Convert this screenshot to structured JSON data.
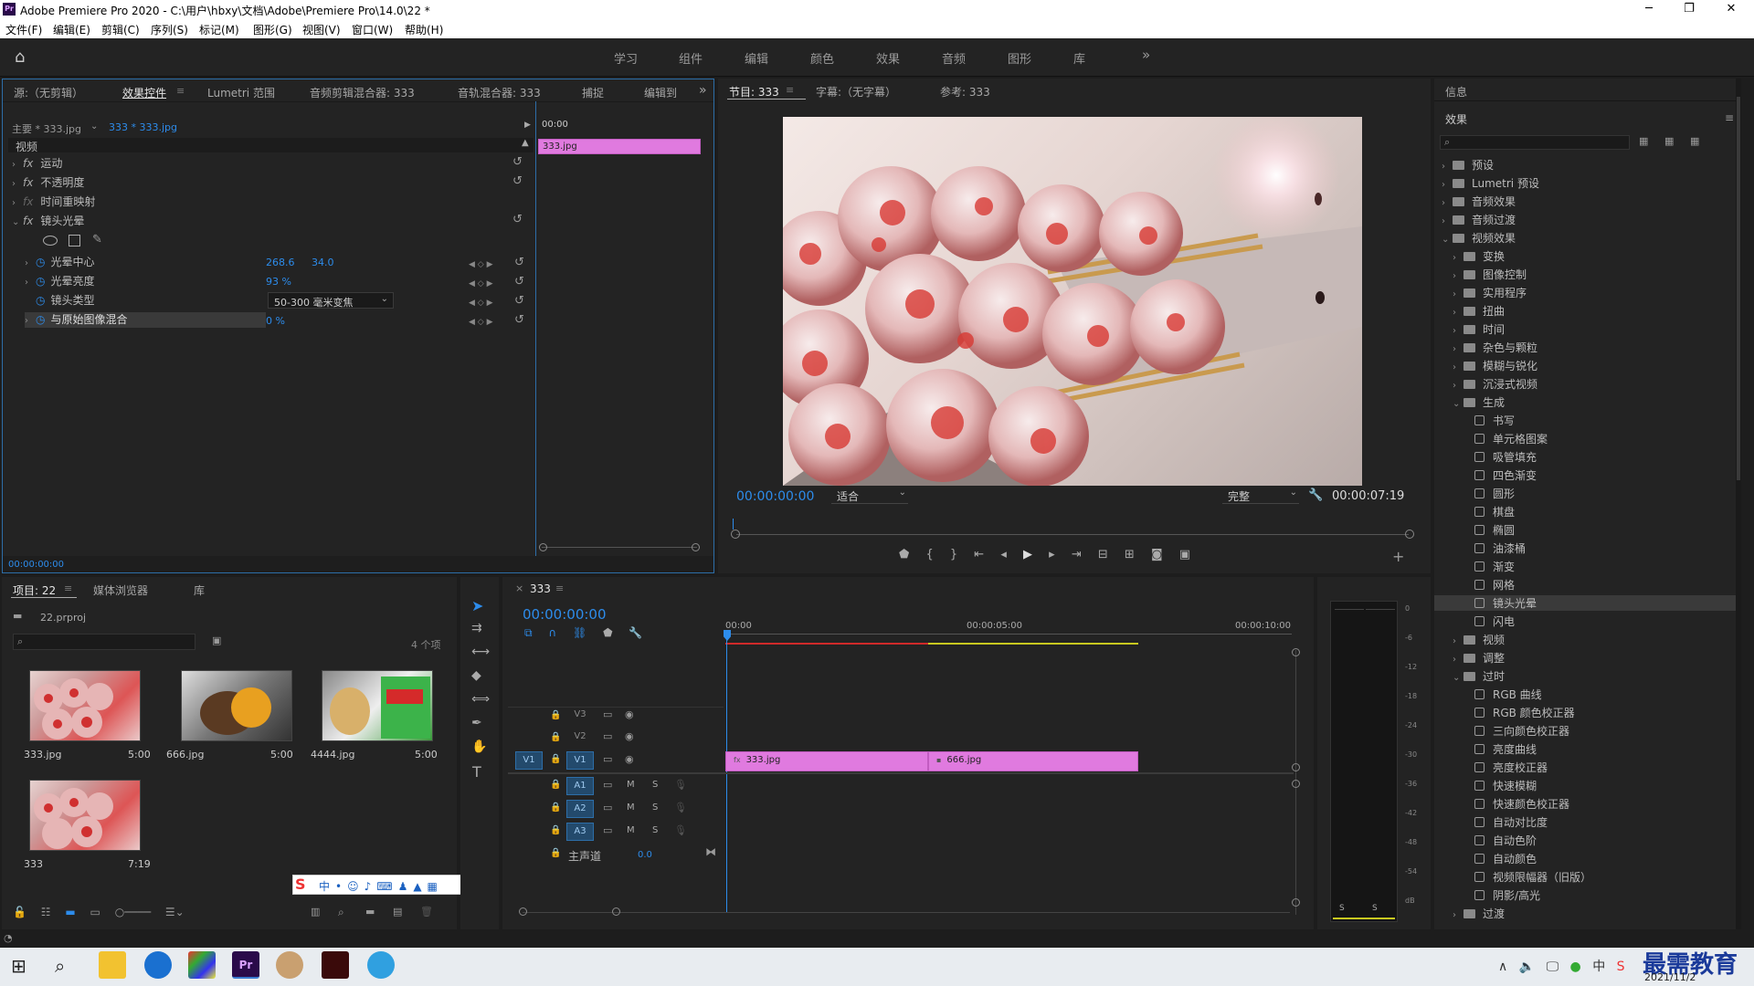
{
  "titlebar": {
    "app_icon": "Pr",
    "title": "Adobe Premiere Pro 2020 - C:\\用户\\hbxy\\文档\\Adobe\\Premiere Pro\\14.0\\22 *",
    "minimize": "─",
    "maximize": "❐",
    "close": "✕"
  },
  "menu": [
    "文件(F)",
    "编辑(E)",
    "剪辑(C)",
    "序列(S)",
    "标记(M)",
    "图形(G)",
    "视图(V)",
    "窗口(W)",
    "帮助(H)"
  ],
  "workspaces": [
    "学习",
    "组件",
    "编辑",
    "颜色",
    "效果",
    "音频",
    "图形",
    "库"
  ],
  "workspace_more": "»",
  "effect_controls": {
    "tabs": [
      "源:（无剪辑）",
      "效果控件",
      "Lumetri 范围",
      "音频剪辑混合器: 333",
      "音轨混合器: 333",
      "捕捉",
      "编辑到"
    ],
    "master": "主要 * 333.jpg",
    "clip": "333 * 333.jpg",
    "timecode_start": "00:00",
    "clip_label": "333.jpg",
    "section": "视频",
    "effects": [
      "运动",
      "不透明度",
      "时间重映射",
      "镜头光晕"
    ],
    "params": [
      {
        "name": "光晕中心",
        "v1": "268.6",
        "v2": "34.0"
      },
      {
        "name": "光晕亮度",
        "v1": "93 %"
      },
      {
        "name": "镜头类型",
        "v1": "50-300 毫米变焦"
      },
      {
        "name": "与原始图像混合",
        "v1": "0 %"
      }
    ],
    "timecode": "00:00:00:00"
  },
  "program": {
    "tabs": [
      "节目: 333",
      "字幕:（无字幕）",
      "参考: 333"
    ],
    "timecode": "00:00:00:00",
    "fit": "适合",
    "quality": "完整",
    "duration": "00:00:07:19"
  },
  "effects_panel": {
    "info_title": "信息",
    "title": "效果",
    "tree": [
      {
        "label": "预设",
        "level": 0,
        "type": "folder",
        "open": false
      },
      {
        "label": "Lumetri 预设",
        "level": 0,
        "type": "folder",
        "open": false
      },
      {
        "label": "音频效果",
        "level": 0,
        "type": "folder",
        "open": false
      },
      {
        "label": "音频过渡",
        "level": 0,
        "type": "folder",
        "open": false
      },
      {
        "label": "视频效果",
        "level": 0,
        "type": "folder",
        "open": true
      },
      {
        "label": "变换",
        "level": 1,
        "type": "folder",
        "open": false
      },
      {
        "label": "图像控制",
        "level": 1,
        "type": "folder",
        "open": false
      },
      {
        "label": "实用程序",
        "level": 1,
        "type": "folder",
        "open": false
      },
      {
        "label": "扭曲",
        "level": 1,
        "type": "folder",
        "open": false
      },
      {
        "label": "时间",
        "level": 1,
        "type": "folder",
        "open": false
      },
      {
        "label": "杂色与颗粒",
        "level": 1,
        "type": "folder",
        "open": false
      },
      {
        "label": "模糊与锐化",
        "level": 1,
        "type": "folder",
        "open": false
      },
      {
        "label": "沉浸式视频",
        "level": 1,
        "type": "folder",
        "open": false
      },
      {
        "label": "生成",
        "level": 1,
        "type": "folder",
        "open": true
      },
      {
        "label": "书写",
        "level": 2,
        "type": "fx"
      },
      {
        "label": "单元格图案",
        "level": 2,
        "type": "fx"
      },
      {
        "label": "吸管填充",
        "level": 2,
        "type": "fx"
      },
      {
        "label": "四色渐变",
        "level": 2,
        "type": "fx"
      },
      {
        "label": "圆形",
        "level": 2,
        "type": "fx"
      },
      {
        "label": "棋盘",
        "level": 2,
        "type": "fx"
      },
      {
        "label": "椭圆",
        "level": 2,
        "type": "fx"
      },
      {
        "label": "油漆桶",
        "level": 2,
        "type": "fx"
      },
      {
        "label": "渐变",
        "level": 2,
        "type": "fx"
      },
      {
        "label": "网格",
        "level": 2,
        "type": "fx"
      },
      {
        "label": "镜头光晕",
        "level": 2,
        "type": "fx",
        "selected": true
      },
      {
        "label": "闪电",
        "level": 2,
        "type": "fx"
      },
      {
        "label": "视频",
        "level": 1,
        "type": "folder",
        "open": false
      },
      {
        "label": "调整",
        "level": 1,
        "type": "folder",
        "open": false
      },
      {
        "label": "过时",
        "level": 1,
        "type": "folder",
        "open": true
      },
      {
        "label": "RGB 曲线",
        "level": 2,
        "type": "fx"
      },
      {
        "label": "RGB 颜色校正器",
        "level": 2,
        "type": "fx"
      },
      {
        "label": "三向颜色校正器",
        "level": 2,
        "type": "fx"
      },
      {
        "label": "亮度曲线",
        "level": 2,
        "type": "fx"
      },
      {
        "label": "亮度校正器",
        "level": 2,
        "type": "fx"
      },
      {
        "label": "快速模糊",
        "level": 2,
        "type": "fx"
      },
      {
        "label": "快速颜色校正器",
        "level": 2,
        "type": "fx"
      },
      {
        "label": "自动对比度",
        "level": 2,
        "type": "fx"
      },
      {
        "label": "自动色阶",
        "level": 2,
        "type": "fx"
      },
      {
        "label": "自动颜色",
        "level": 2,
        "type": "fx"
      },
      {
        "label": "视频限幅器（旧版）",
        "level": 2,
        "type": "fx"
      },
      {
        "label": "阴影/高光",
        "level": 2,
        "type": "fx"
      },
      {
        "label": "过渡",
        "level": 1,
        "type": "folder",
        "open": false
      }
    ]
  },
  "project": {
    "tabs": [
      "项目: 22",
      "媒体浏览器",
      "库"
    ],
    "file": "22.prproj",
    "count": "4 个项",
    "items": [
      {
        "name": "333.jpg",
        "dur": "5:00"
      },
      {
        "name": "666.jpg",
        "dur": "5:00"
      },
      {
        "name": "4444.jpg",
        "dur": "5:00"
      },
      {
        "name": "333",
        "dur": "7:19"
      }
    ]
  },
  "timeline": {
    "tab": "333",
    "timecode": "00:00:00:00",
    "ruler": [
      "00:00",
      "00:00:05:00",
      "00:00:10:00"
    ],
    "video_tracks": [
      "V3",
      "V2",
      "V1"
    ],
    "audio_tracks": [
      "A1",
      "A2",
      "A3"
    ],
    "source_v": "V1",
    "mute": "M",
    "solo": "S",
    "master": "主声道",
    "master_val": "0.0",
    "clips": [
      {
        "name": "333.jpg"
      },
      {
        "name": "666.jpg"
      }
    ]
  },
  "meter": {
    "ticks": [
      "0",
      "-6",
      "-12",
      "-18",
      "-24",
      "-30",
      "-36",
      "-42",
      "-48",
      "-54",
      "dB"
    ],
    "s1": "S",
    "s2": "S"
  },
  "taskbar": {
    "date": "2021/11/2",
    "time": "",
    "watermark": "最需教育"
  }
}
